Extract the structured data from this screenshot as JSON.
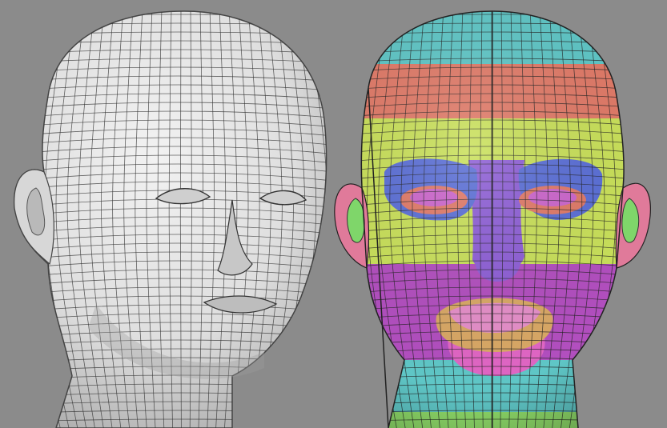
{
  "scene": {
    "background": "#8b8b8b",
    "left_head": {
      "style": "grey-wireframe",
      "base_color": "#e6e6e6",
      "shade_color": "#bdbdbd",
      "line_color": "#333333"
    },
    "right_head": {
      "style": "color-zoned-topology",
      "line_color": "#222222",
      "zone_colors": {
        "scalp": "#5fc6c6",
        "crown": "#e07a68",
        "forehead": "#c9e05a",
        "eye_ring": "#5b6fd6",
        "eye_inner": "#e07a68",
        "eyelid": "#cc66cc",
        "nose_mask": "#8e5fd6",
        "cheeks": "#c9e05a",
        "mid_band": "#b24fbf",
        "mouth_ring": "#d9a866",
        "lips": "#e58fc9",
        "chin": "#e066c4",
        "jaw": "#b24fbf",
        "neck": "#5fc6c6",
        "neck_low": "#8fdc6a",
        "ear_outer": "#e07a9a",
        "ear_inner": "#7fd66a"
      }
    }
  }
}
